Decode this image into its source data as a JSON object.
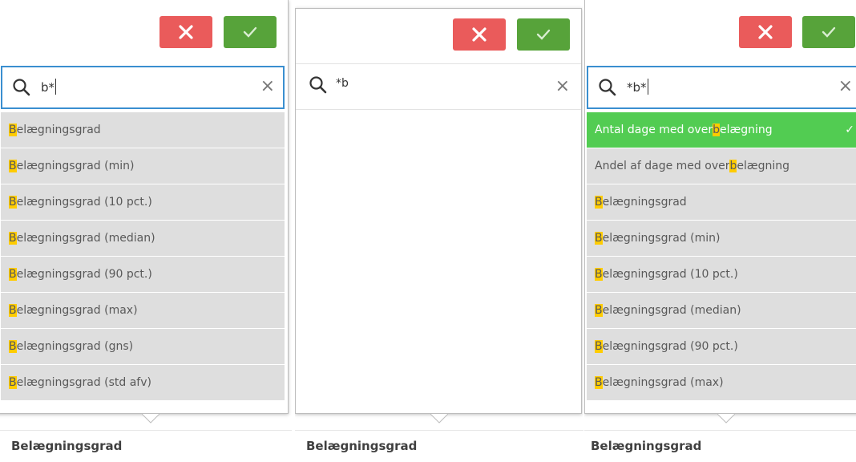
{
  "panels": [
    {
      "query_before_caret": "b*",
      "items": [
        {
          "pre": "",
          "hl": "B",
          "post": "elægningsgrad"
        },
        {
          "pre": "",
          "hl": "B",
          "post": "elægningsgrad (min)"
        },
        {
          "pre": "",
          "hl": "B",
          "post": "elægningsgrad (10 pct.)"
        },
        {
          "pre": "",
          "hl": "B",
          "post": "elægningsgrad (median)"
        },
        {
          "pre": "",
          "hl": "B",
          "post": "elægningsgrad (90 pct.)"
        },
        {
          "pre": "",
          "hl": "B",
          "post": "elægningsgrad (max)"
        },
        {
          "pre": "",
          "hl": "B",
          "post": "elægningsgrad (gns)"
        },
        {
          "pre": "",
          "hl": "B",
          "post": "elægningsgrad (std afv)"
        }
      ],
      "footer_label": "Belægningsgrad"
    },
    {
      "query_before_caret": "*b",
      "items": [],
      "footer_label": "Belægningsgrad"
    },
    {
      "query_before_caret": "*b*",
      "items": [
        {
          "pre": "Antal dage med over",
          "hl": "b",
          "post": "elægning",
          "selected": true,
          "check": "✓"
        },
        {
          "pre": "Andel af dage med over",
          "hl": "b",
          "post": "elægning"
        },
        {
          "pre": "",
          "hl": "B",
          "post": "elægningsgrad"
        },
        {
          "pre": "",
          "hl": "B",
          "post": "elægningsgrad (min)"
        },
        {
          "pre": "",
          "hl": "B",
          "post": "elægningsgrad (10 pct.)"
        },
        {
          "pre": "",
          "hl": "B",
          "post": "elægningsgrad (median)"
        },
        {
          "pre": "",
          "hl": "B",
          "post": "elægningsgrad (90 pct.)"
        },
        {
          "pre": "",
          "hl": "B",
          "post": "elægningsgrad (max)"
        }
      ],
      "footer_label": "Belægningsgrad"
    }
  ],
  "clear_glyph": "×",
  "colors": {
    "cancel": "#ea5b5b",
    "confirm": "#57a33a",
    "selected": "#52cc52",
    "highlight": "#ffcc00",
    "search_border": "#3a8fd0",
    "item_bg": "#dedede"
  }
}
